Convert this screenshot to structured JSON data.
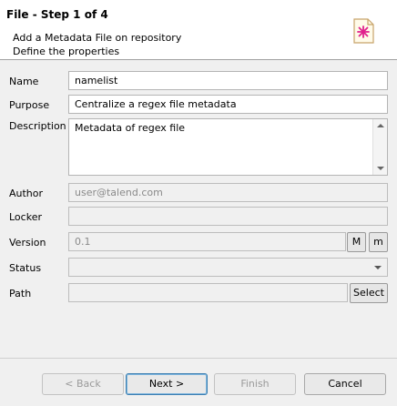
{
  "header": {
    "title": "File - Step 1 of 4",
    "line1": "Add a Metadata File on repository",
    "line2": "Define the properties",
    "icon": "metadata-file-icon"
  },
  "form": {
    "name": {
      "label": "Name",
      "value": "namelist"
    },
    "purpose": {
      "label": "Purpose",
      "value": "Centralize a regex file metadata"
    },
    "description": {
      "label": "Description",
      "value": "Metadata of regex file"
    },
    "author": {
      "label": "Author",
      "value": "user@talend.com"
    },
    "locker": {
      "label": "Locker",
      "value": ""
    },
    "version": {
      "label": "Version",
      "value": "0.1",
      "major_label": "M",
      "minor_label": "m"
    },
    "status": {
      "label": "Status",
      "value": ""
    },
    "path": {
      "label": "Path",
      "value": "",
      "select_label": "Select"
    }
  },
  "buttons": {
    "back": "< Back",
    "next": "Next >",
    "finish": "Finish",
    "cancel": "Cancel"
  },
  "colors": {
    "icon_accent": "#e0208c",
    "icon_frame": "#c8a46a"
  }
}
